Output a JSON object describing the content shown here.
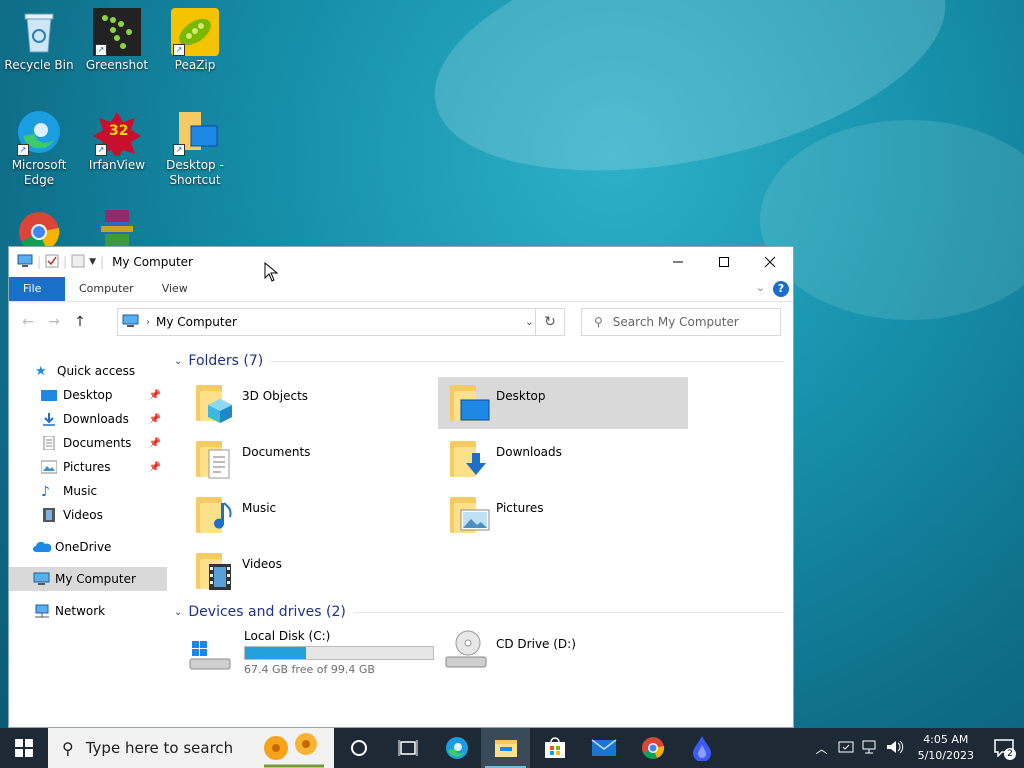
{
  "desktop": {
    "icons": [
      {
        "label": "Recycle Bin"
      },
      {
        "label": "Greenshot"
      },
      {
        "label": "PeaZip"
      },
      {
        "label": "Microsoft Edge"
      },
      {
        "label": "IrfanView"
      },
      {
        "label": "Desktop - Shortcut"
      }
    ],
    "irfan_badge": "32"
  },
  "window": {
    "title": "My Computer",
    "ribbon_tabs": [
      "File",
      "Computer",
      "View"
    ],
    "address_path": "My Computer",
    "search_placeholder": "Search My Computer",
    "help_label": "?"
  },
  "sidebar": {
    "quick_access": "Quick access",
    "quick_items": [
      "Desktop",
      "Downloads",
      "Documents",
      "Pictures",
      "Music",
      "Videos"
    ],
    "onedrive": "OneDrive",
    "my_computer": "My Computer",
    "network": "Network"
  },
  "content": {
    "folders_header": "Folders (7)",
    "folders": [
      "3D Objects",
      "Desktop",
      "Documents",
      "Downloads",
      "Music",
      "Pictures",
      "Videos"
    ],
    "drives_header": "Devices and drives (2)",
    "drives": [
      {
        "name": "Local Disk (C:)",
        "free_text": "67.4 GB free of 99.4 GB",
        "used_fraction": 0.322
      },
      {
        "name": "CD Drive (D:)"
      }
    ]
  },
  "taskbar": {
    "search_placeholder": "Type here to search",
    "time": "4:05 AM",
    "date": "5/10/2023",
    "notification_count": "2"
  },
  "colors": {
    "accent": "#1a6fc9",
    "drive_fill": "#26a0da",
    "taskbar": "#1d2a36"
  }
}
